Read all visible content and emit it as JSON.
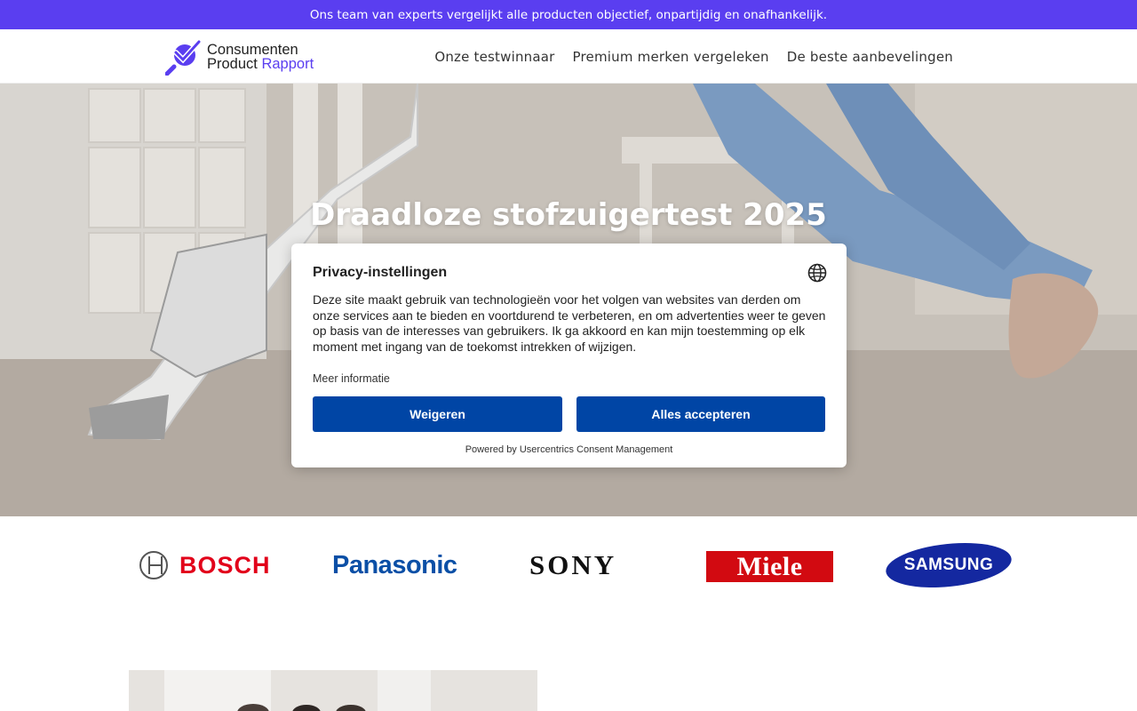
{
  "announcement": "Ons team van experts vergelijkt alle producten objectief, onpartijdig en onafhankelijk.",
  "logo": {
    "line1": "Consumenten",
    "line2_a": "Product ",
    "line2_b": "Rapport",
    "icon": "magnifier-check-icon"
  },
  "nav": [
    {
      "label": "Onze testwinnaar"
    },
    {
      "label": "Premium merken vergeleken"
    },
    {
      "label": "De beste aanbevelingen"
    }
  ],
  "hero": {
    "title": "Draadloze stofzuigertest 2025"
  },
  "brands": [
    {
      "name": "BOSCH"
    },
    {
      "name": "Panasonic"
    },
    {
      "name": "SONY"
    },
    {
      "name": "Miele"
    },
    {
      "name": "SAMSUNG"
    }
  ],
  "consent": {
    "title": "Privacy-instellingen",
    "globe_icon": "globe-icon",
    "body": "Deze site maakt gebruik van technologieën voor het volgen van websites van derden om onze services aan te bieden en voortdurend te verbeteren, en om advertenties weer te geven op basis van de interesses van gebruikers. Ik ga akkoord en kan mijn toestemming op elk moment met ingang van de toekomst intrekken of wijzigen.",
    "more_info": "Meer informatie",
    "deny_label": "Weigeren",
    "accept_label": "Alles accepteren",
    "powered_by": "Powered by Usercentrics Consent Management"
  },
  "colors": {
    "brand": "#5a3ef0",
    "button": "#0045a5"
  }
}
